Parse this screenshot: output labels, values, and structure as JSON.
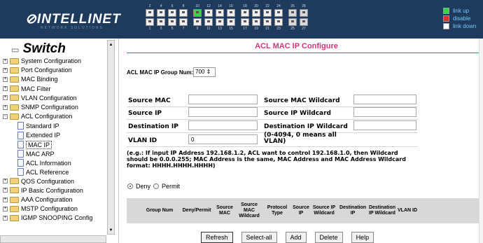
{
  "brand": {
    "name": "INTELLINET",
    "tagline": "NETWORK SOLUTIONS"
  },
  "ports": {
    "top_numbers": [
      "2",
      "4",
      "6",
      "8",
      "10",
      "12",
      "14",
      "16",
      "18",
      "20",
      "22",
      "24",
      "26",
      "28"
    ],
    "bottom_numbers": [
      "1",
      "3",
      "5",
      "7",
      "9",
      "11",
      "13",
      "15",
      "17",
      "19",
      "21",
      "23",
      "25",
      "27"
    ],
    "green_top": [
      4
    ],
    "green_bottom": []
  },
  "legend": [
    {
      "label": "link up",
      "color": "#3fd33f"
    },
    {
      "label": "disable",
      "color": "#e52b2b"
    },
    {
      "label": "link down",
      "color": "#ffffff"
    }
  ],
  "sidebar": {
    "title": "Switch",
    "items": [
      {
        "label": "System Configuration",
        "kind": "folder",
        "level": 0
      },
      {
        "label": "Port Configuration",
        "kind": "folder",
        "level": 0
      },
      {
        "label": "MAC Binding",
        "kind": "folder",
        "level": 0
      },
      {
        "label": "MAC Filter",
        "kind": "folder",
        "level": 0
      },
      {
        "label": "VLAN Configuration",
        "kind": "folder",
        "level": 0
      },
      {
        "label": "SNMP Configuration",
        "kind": "folder",
        "level": 0
      },
      {
        "label": "ACL Configuration",
        "kind": "folder-open",
        "level": 0
      },
      {
        "label": "Standard IP",
        "kind": "doc",
        "level": 1
      },
      {
        "label": "Extended IP",
        "kind": "doc",
        "level": 1
      },
      {
        "label": "MAC IP",
        "kind": "doc",
        "level": 1,
        "selected": true
      },
      {
        "label": "MAC ARP",
        "kind": "doc",
        "level": 1
      },
      {
        "label": "ACL Information",
        "kind": "doc",
        "level": 1
      },
      {
        "label": "ACL Reference",
        "kind": "doc",
        "level": 1
      },
      {
        "label": "QOS Configuration",
        "kind": "folder",
        "level": 0
      },
      {
        "label": "IP Basic Configuration",
        "kind": "folder",
        "level": 0
      },
      {
        "label": "AAA Configuration",
        "kind": "folder",
        "level": 0
      },
      {
        "label": "MSTP Configuration",
        "kind": "folder",
        "level": 0
      },
      {
        "label": "IGMP SNOOPING Config",
        "kind": "folder",
        "level": 0
      }
    ]
  },
  "main": {
    "title": "ACL MAC IP Configure",
    "group_label": "ACL MAC IP Group Num:",
    "group_value": "700",
    "fields": {
      "source_mac": "Source MAC",
      "source_mac_wildcard": "Source MAC Wildcard",
      "source_ip": "Source IP",
      "source_ip_wildcard": "Source IP Wildcard",
      "destination_ip": "Destination IP",
      "destination_ip_wildcard": "Destination IP Wildcard",
      "vlan_id": "VLAN ID",
      "vlan_value": "0",
      "vlan_hint": "(0-4094, 0 means all VLAN)"
    },
    "note": "(e.g.: If input IP Address 192.168.1.2, ACL want to control 192.168.1.0, then Wildcard should be 0.0.0.255; MAC Address is the same, MAC Address and MAC Address Wildcard format: HHHH.HHHH.HHHH)",
    "radio": {
      "deny": "Deny",
      "permit": "Permit",
      "selected": "deny"
    },
    "table_headers": [
      "",
      "Group Num",
      "Deny/Permit",
      "Source MAC",
      "Source MAC Wildcard",
      "Protocol Type",
      "Source IP",
      "Source IP Wildcard",
      "Destination IP",
      "Destination IP Wildcard",
      "VLAN ID"
    ],
    "buttons": {
      "refresh": "Refresh",
      "select_all": "Select-all",
      "add": "Add",
      "delete": "Delete",
      "help": "Help"
    }
  }
}
